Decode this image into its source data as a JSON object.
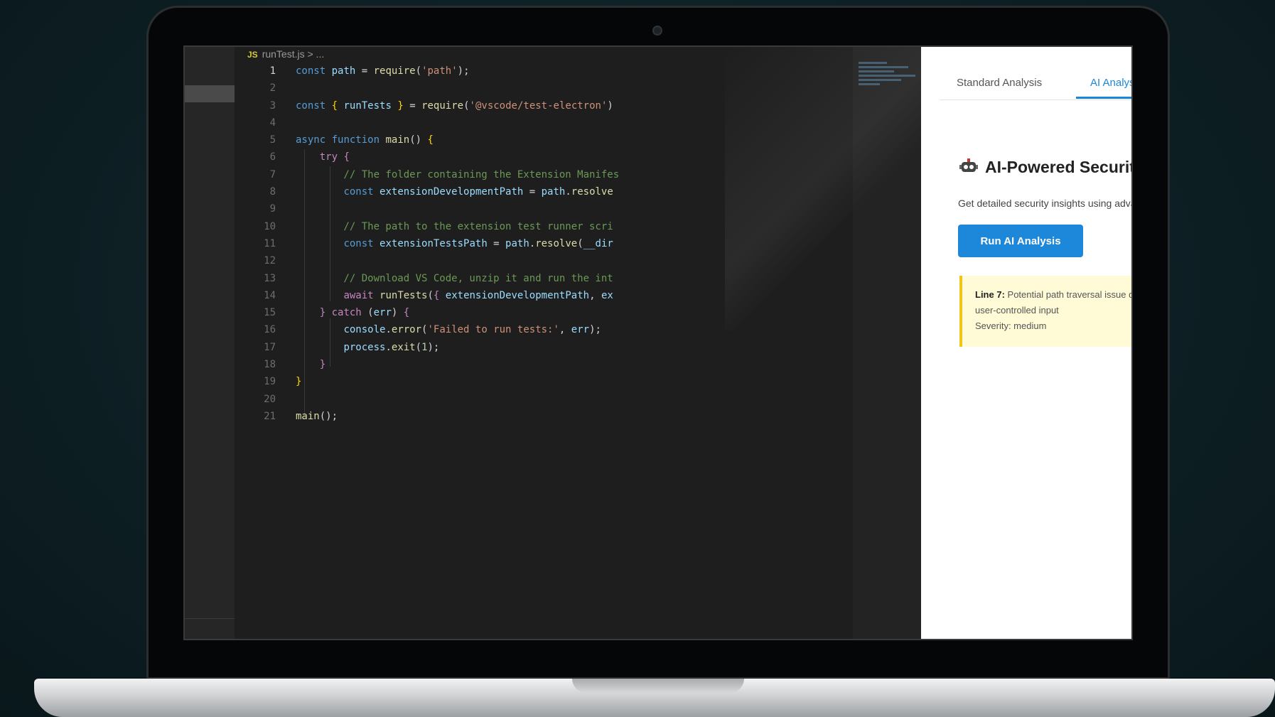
{
  "editor": {
    "breadcrumb": "runTest.js > ...",
    "breadcrumb_icon": "JS",
    "line_numbers": [
      "1",
      "2",
      "3",
      "4",
      "5",
      "6",
      "7",
      "8",
      "9",
      "10",
      "11",
      "12",
      "13",
      "14",
      "15",
      "16",
      "17",
      "18",
      "19",
      "20",
      "21"
    ],
    "lines": [
      "const path = require('path');",
      "",
      "const { runTests } = require('@vscode/test-electron')",
      "",
      "async function main() {",
      "    try {",
      "        // The folder containing the Extension Manifes",
      "        const extensionDevelopmentPath = path.resolve",
      "",
      "        // The path to the extension test runner scri",
      "        const extensionTestsPath = path.resolve(__dir",
      "",
      "        // Download VS Code, unzip it and run the int",
      "        await runTests({ extensionDevelopmentPath, ex",
      "    } catch (err) {",
      "        console.error('Failed to run tests:', err);",
      "        process.exit(1);",
      "    }",
      "}",
      "",
      "main();"
    ]
  },
  "panel": {
    "tabs": [
      "Standard Analysis",
      "AI Analysis"
    ],
    "active_tab": "AI Analysis",
    "title": "AI-Powered Security Analysis",
    "description": "Get detailed security insights using advanced AI analysis of your code",
    "run_button": "Run AI Analysis",
    "finding": {
      "line_label": "Line 7:",
      "message": "Potential path traversal issue due to the use of 'path.resolve'",
      "message_cont": "user-controlled input",
      "severity": "Severity: medium"
    }
  },
  "colors": {
    "accent": "#1d87d9",
    "warning_bg": "#fffbd6",
    "warning_border": "#f0c419",
    "editor_bg": "#1e1e1e"
  }
}
